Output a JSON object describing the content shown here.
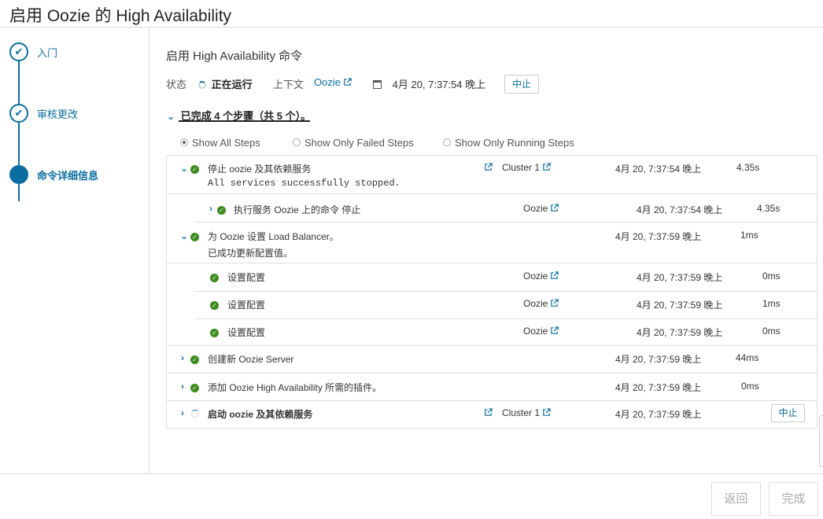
{
  "window": {
    "title": "启用 Oozie 的 High Availability"
  },
  "sidebar": {
    "items": [
      {
        "label": "入门",
        "state": "done"
      },
      {
        "label": "审核更改",
        "state": "done"
      },
      {
        "label": "命令详细信息",
        "state": "active"
      }
    ]
  },
  "command": {
    "title": "启用 High Availability 命令",
    "status_label": "状态",
    "status_value": "正在运行",
    "context_label": "上下文",
    "context_value": "Oozie",
    "timestamp": "4月 20, 7:37:54 晚上",
    "abort_label": "中止"
  },
  "summary": {
    "text": "已完成 4 个步骤（共 5 个）。"
  },
  "filters": [
    {
      "label": "Show All Steps",
      "selected": true
    },
    {
      "label": "Show Only Failed Steps",
      "selected": false
    },
    {
      "label": "Show Only Running Steps",
      "selected": false
    }
  ],
  "steps": [
    {
      "name": "停止 oozie 及其依赖服务",
      "detail": "All services successfully stopped.",
      "context": "Cluster 1",
      "time": "4月 20, 7:37:54 晚上",
      "duration": "4.35s"
    },
    {
      "name": "执行服务 Oozie 上的命令 停止",
      "context": "Oozie",
      "time": "4月 20, 7:37:54 晚上",
      "duration": "4.35s"
    },
    {
      "name": "为 Oozie 设置 Load Balancer。",
      "detail": "已成功更新配置值。",
      "time": "4月 20, 7:37:59 晚上",
      "duration": "1ms"
    },
    {
      "name": "设置配置",
      "context": "Oozie",
      "time": "4月 20, 7:37:59 晚上",
      "duration": "0ms"
    },
    {
      "name": "设置配置",
      "context": "Oozie",
      "time": "4月 20, 7:37:59 晚上",
      "duration": "1ms"
    },
    {
      "name": "设置配置",
      "context": "Oozie",
      "time": "4月 20, 7:37:59 晚上",
      "duration": "0ms"
    },
    {
      "name": "创建新 Oozie Server",
      "time": "4月 20, 7:37:59 晚上",
      "duration": "44ms"
    },
    {
      "name": "添加 Oozie High Availability 所需的插件。",
      "time": "4月 20, 7:37:59 晚上",
      "duration": "0ms"
    },
    {
      "name": "启动 oozie 及其依赖服务",
      "context": "Cluster 1",
      "time": "4月 20, 7:37:59 晚上",
      "abort_label": "中止"
    }
  ],
  "footer": {
    "back_label": "返回",
    "finish_label": "完成"
  },
  "icons": {
    "success": "check-circle-icon",
    "running": "spinner-icon",
    "external": "external-link-icon",
    "calendar": "calendar-icon"
  },
  "colors": {
    "accent": "#0b6ea1",
    "success": "#3c8a1d",
    "border": "#dddddd"
  }
}
